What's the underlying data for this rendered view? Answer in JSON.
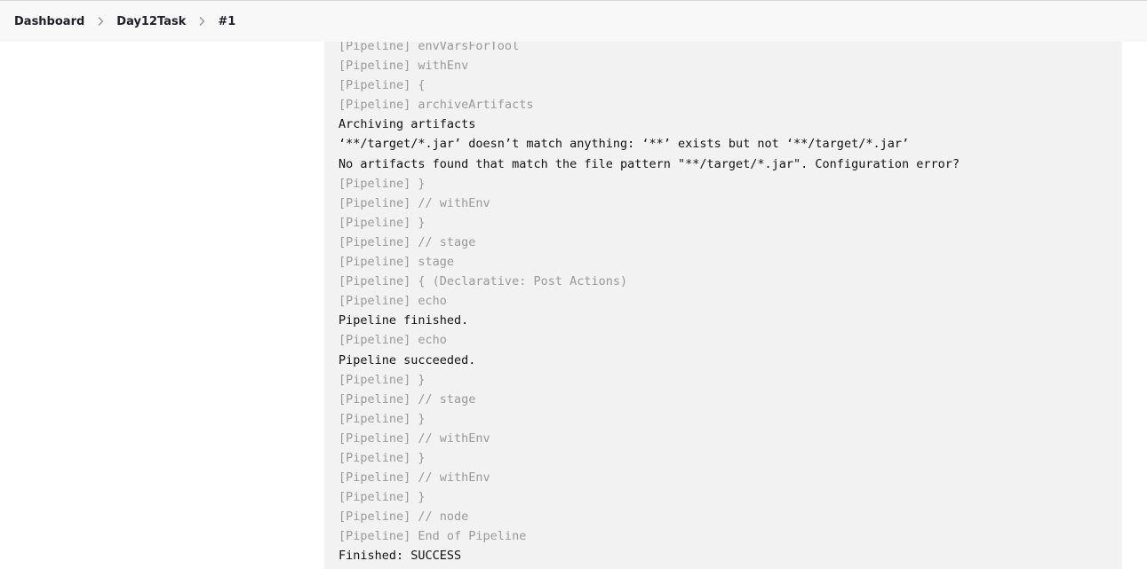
{
  "breadcrumb": {
    "items": [
      {
        "label": "Dashboard"
      },
      {
        "label": "Day12Task"
      },
      {
        "label": "#1"
      }
    ],
    "separator_icon": "chevron-right-icon"
  },
  "console": {
    "lines": [
      {
        "text": "[Pipeline] envVarsForTool",
        "kind": "pipeline"
      },
      {
        "text": "[Pipeline] withEnv",
        "kind": "pipeline"
      },
      {
        "text": "[Pipeline] {",
        "kind": "pipeline"
      },
      {
        "text": "[Pipeline] archiveArtifacts",
        "kind": "pipeline"
      },
      {
        "text": "Archiving artifacts",
        "kind": "output"
      },
      {
        "text": "‘**/target/*.jar’ doesn’t match anything: ‘**’ exists but not ‘**/target/*.jar’",
        "kind": "output"
      },
      {
        "text": "No artifacts found that match the file pattern \"**/target/*.jar\". Configuration error?",
        "kind": "output"
      },
      {
        "text": "[Pipeline] }",
        "kind": "pipeline"
      },
      {
        "text": "[Pipeline] // withEnv",
        "kind": "pipeline"
      },
      {
        "text": "[Pipeline] }",
        "kind": "pipeline"
      },
      {
        "text": "[Pipeline] // stage",
        "kind": "pipeline"
      },
      {
        "text": "[Pipeline] stage",
        "kind": "pipeline"
      },
      {
        "text": "[Pipeline] { (Declarative: Post Actions)",
        "kind": "pipeline"
      },
      {
        "text": "[Pipeline] echo",
        "kind": "pipeline"
      },
      {
        "text": "Pipeline finished.",
        "kind": "output"
      },
      {
        "text": "[Pipeline] echo",
        "kind": "pipeline"
      },
      {
        "text": "Pipeline succeeded.",
        "kind": "output"
      },
      {
        "text": "[Pipeline] }",
        "kind": "pipeline"
      },
      {
        "text": "[Pipeline] // stage",
        "kind": "pipeline"
      },
      {
        "text": "[Pipeline] }",
        "kind": "pipeline"
      },
      {
        "text": "[Pipeline] // withEnv",
        "kind": "pipeline"
      },
      {
        "text": "[Pipeline] }",
        "kind": "pipeline"
      },
      {
        "text": "[Pipeline] // withEnv",
        "kind": "pipeline"
      },
      {
        "text": "[Pipeline] }",
        "kind": "pipeline"
      },
      {
        "text": "[Pipeline] // node",
        "kind": "pipeline"
      },
      {
        "text": "[Pipeline] End of Pipeline",
        "kind": "pipeline"
      },
      {
        "text": "Finished: SUCCESS",
        "kind": "output"
      }
    ]
  },
  "colors": {
    "pipeline_text": "#999999",
    "output_text": "#111111",
    "console_background": "#f2f2f2",
    "topbar_background": "#f8f8f9"
  }
}
